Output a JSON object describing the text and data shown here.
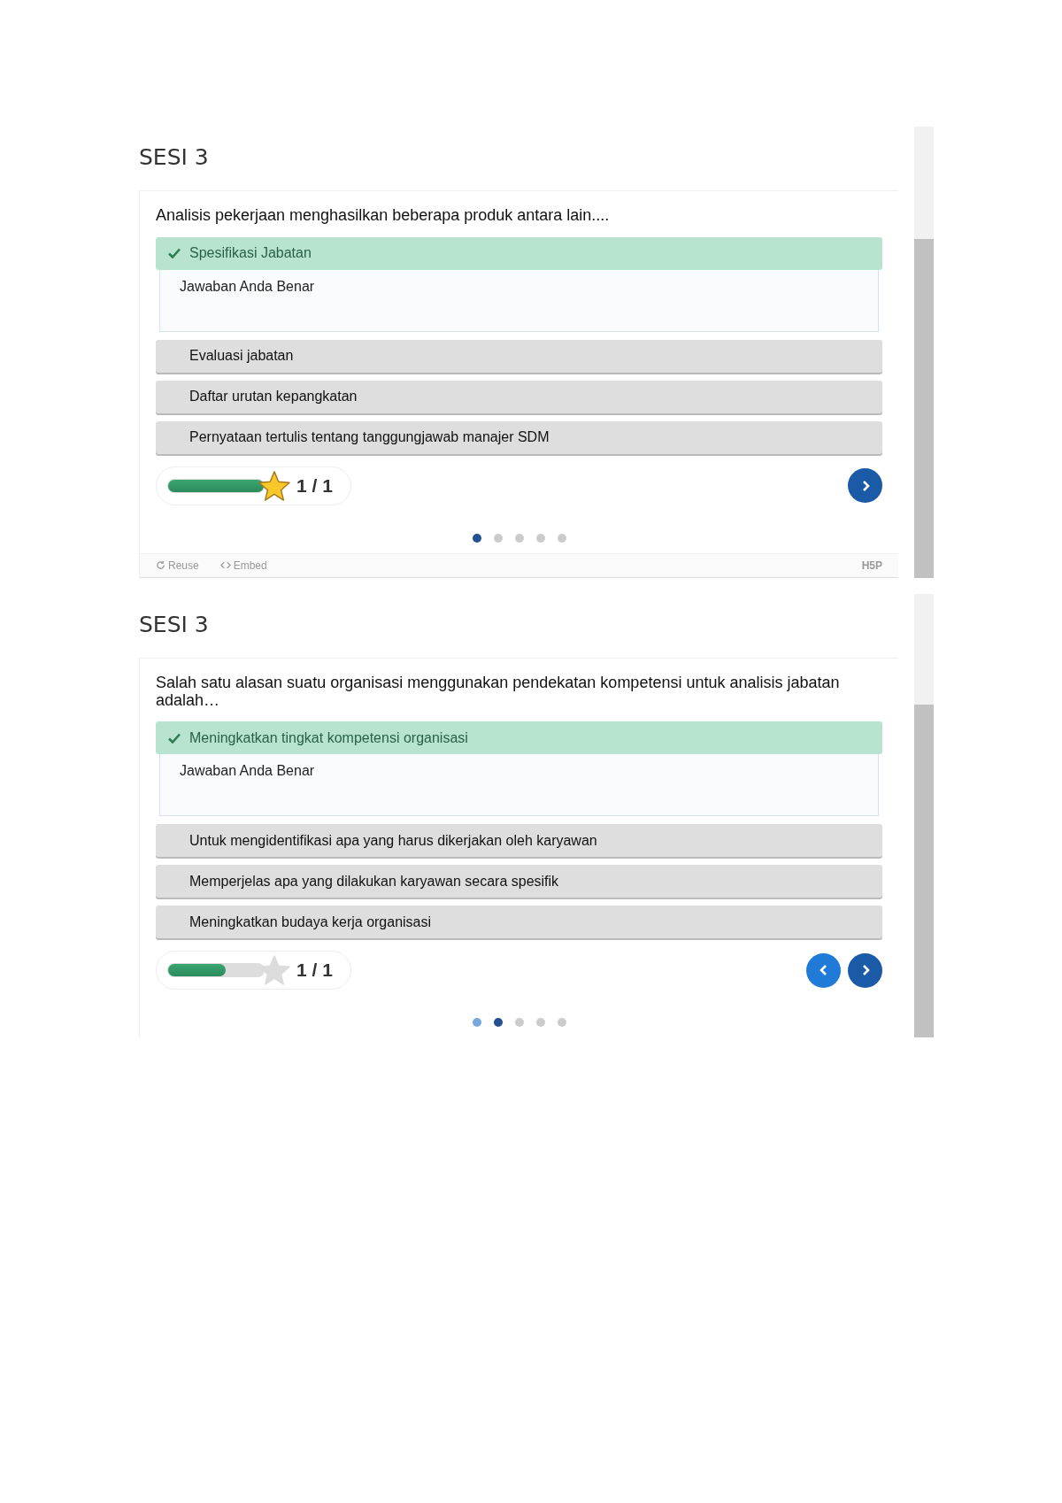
{
  "sections": [
    {
      "title": "SESI 3",
      "question": "Analisis pekerjaan menghasilkan beberapa produk antara lain....",
      "answers": [
        {
          "text": "Spesifikasi Jabatan",
          "correct": true,
          "feedback": "Jawaban Anda Benar"
        },
        {
          "text": "Evaluasi jabatan",
          "correct": false
        },
        {
          "text": "Daftar urutan kepangkatan",
          "correct": false
        },
        {
          "text": "Pernyataan tertulis tentang tanggungjawab manajer SDM",
          "correct": false
        }
      ],
      "score": {
        "level": 1,
        "star_earned": true,
        "text": "1 / 1"
      },
      "nav": {
        "prev": false,
        "next": true
      },
      "dots": [
        {
          "kind": "current"
        },
        {
          "kind": "unvisited"
        },
        {
          "kind": "unvisited"
        },
        {
          "kind": "unvisited"
        },
        {
          "kind": "unvisited"
        }
      ],
      "footer": {
        "reuse": "Reuse",
        "embed": "Embed",
        "badge": "H5P"
      }
    },
    {
      "title": "SESI 3",
      "question": "Salah satu alasan suatu organisasi menggunakan pendekatan kompetensi untuk analisis jabatan adalah…",
      "answers": [
        {
          "text": "Meningkatkan tingkat kompetensi organisasi",
          "correct": true,
          "feedback": "Jawaban Anda Benar"
        },
        {
          "text": "Untuk mengidentifikasi apa yang harus dikerjakan oleh karyawan",
          "correct": false
        },
        {
          "text": "Memperjelas apa yang dilakukan karyawan secara spesifik",
          "correct": false
        },
        {
          "text": "Meningkatkan budaya kerja organisasi",
          "correct": false
        }
      ],
      "score": {
        "level": 0.6,
        "star_earned": false,
        "text": "1 / 1"
      },
      "nav": {
        "prev": true,
        "next": true
      },
      "dots": [
        {
          "kind": "visited"
        },
        {
          "kind": "current"
        },
        {
          "kind": "unvisited"
        },
        {
          "kind": "unvisited"
        },
        {
          "kind": "unvisited"
        }
      ]
    }
  ]
}
